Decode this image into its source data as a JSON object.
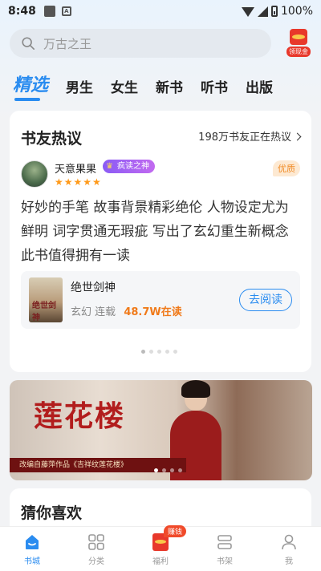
{
  "status_bar": {
    "time": "8:48",
    "battery": "100%"
  },
  "search": {
    "placeholder": "万古之王",
    "reward_label": "领现金"
  },
  "tabs": [
    {
      "label": "精选",
      "active": true
    },
    {
      "label": "男生"
    },
    {
      "label": "女生"
    },
    {
      "label": "新书"
    },
    {
      "label": "听书"
    },
    {
      "label": "出版"
    }
  ],
  "discussion": {
    "title": "书友热议",
    "count_text": "198万书友正在热议",
    "user": {
      "name": "天意果果",
      "badge": "疯读之神",
      "stars": "★★★★★"
    },
    "quality_tag": "优质",
    "review": "好妙的手笔 故事背景精彩绝伦 人物设定尤为鲜明 词字贯通无瑕疵 写出了玄幻重生新概念 此书值得拥有一读",
    "book": {
      "title": "绝世剑神",
      "cover_text": "绝世剑神",
      "genre": "玄幻",
      "status": "连载",
      "reads": "48.7W在读",
      "button": "去阅读"
    }
  },
  "banner": {
    "title": "莲花楼",
    "subtitle": "改编自藤萍作品《吉祥纹莲花楼》"
  },
  "guess": {
    "title": "猜你喜欢"
  },
  "nav": [
    {
      "label": "书城",
      "active": true
    },
    {
      "label": "分类"
    },
    {
      "label": "福利",
      "badge": "赚钱"
    },
    {
      "label": "书架"
    },
    {
      "label": "我"
    }
  ],
  "colors": {
    "accent": "#2a8cf0",
    "reads": "#f07a1a"
  }
}
